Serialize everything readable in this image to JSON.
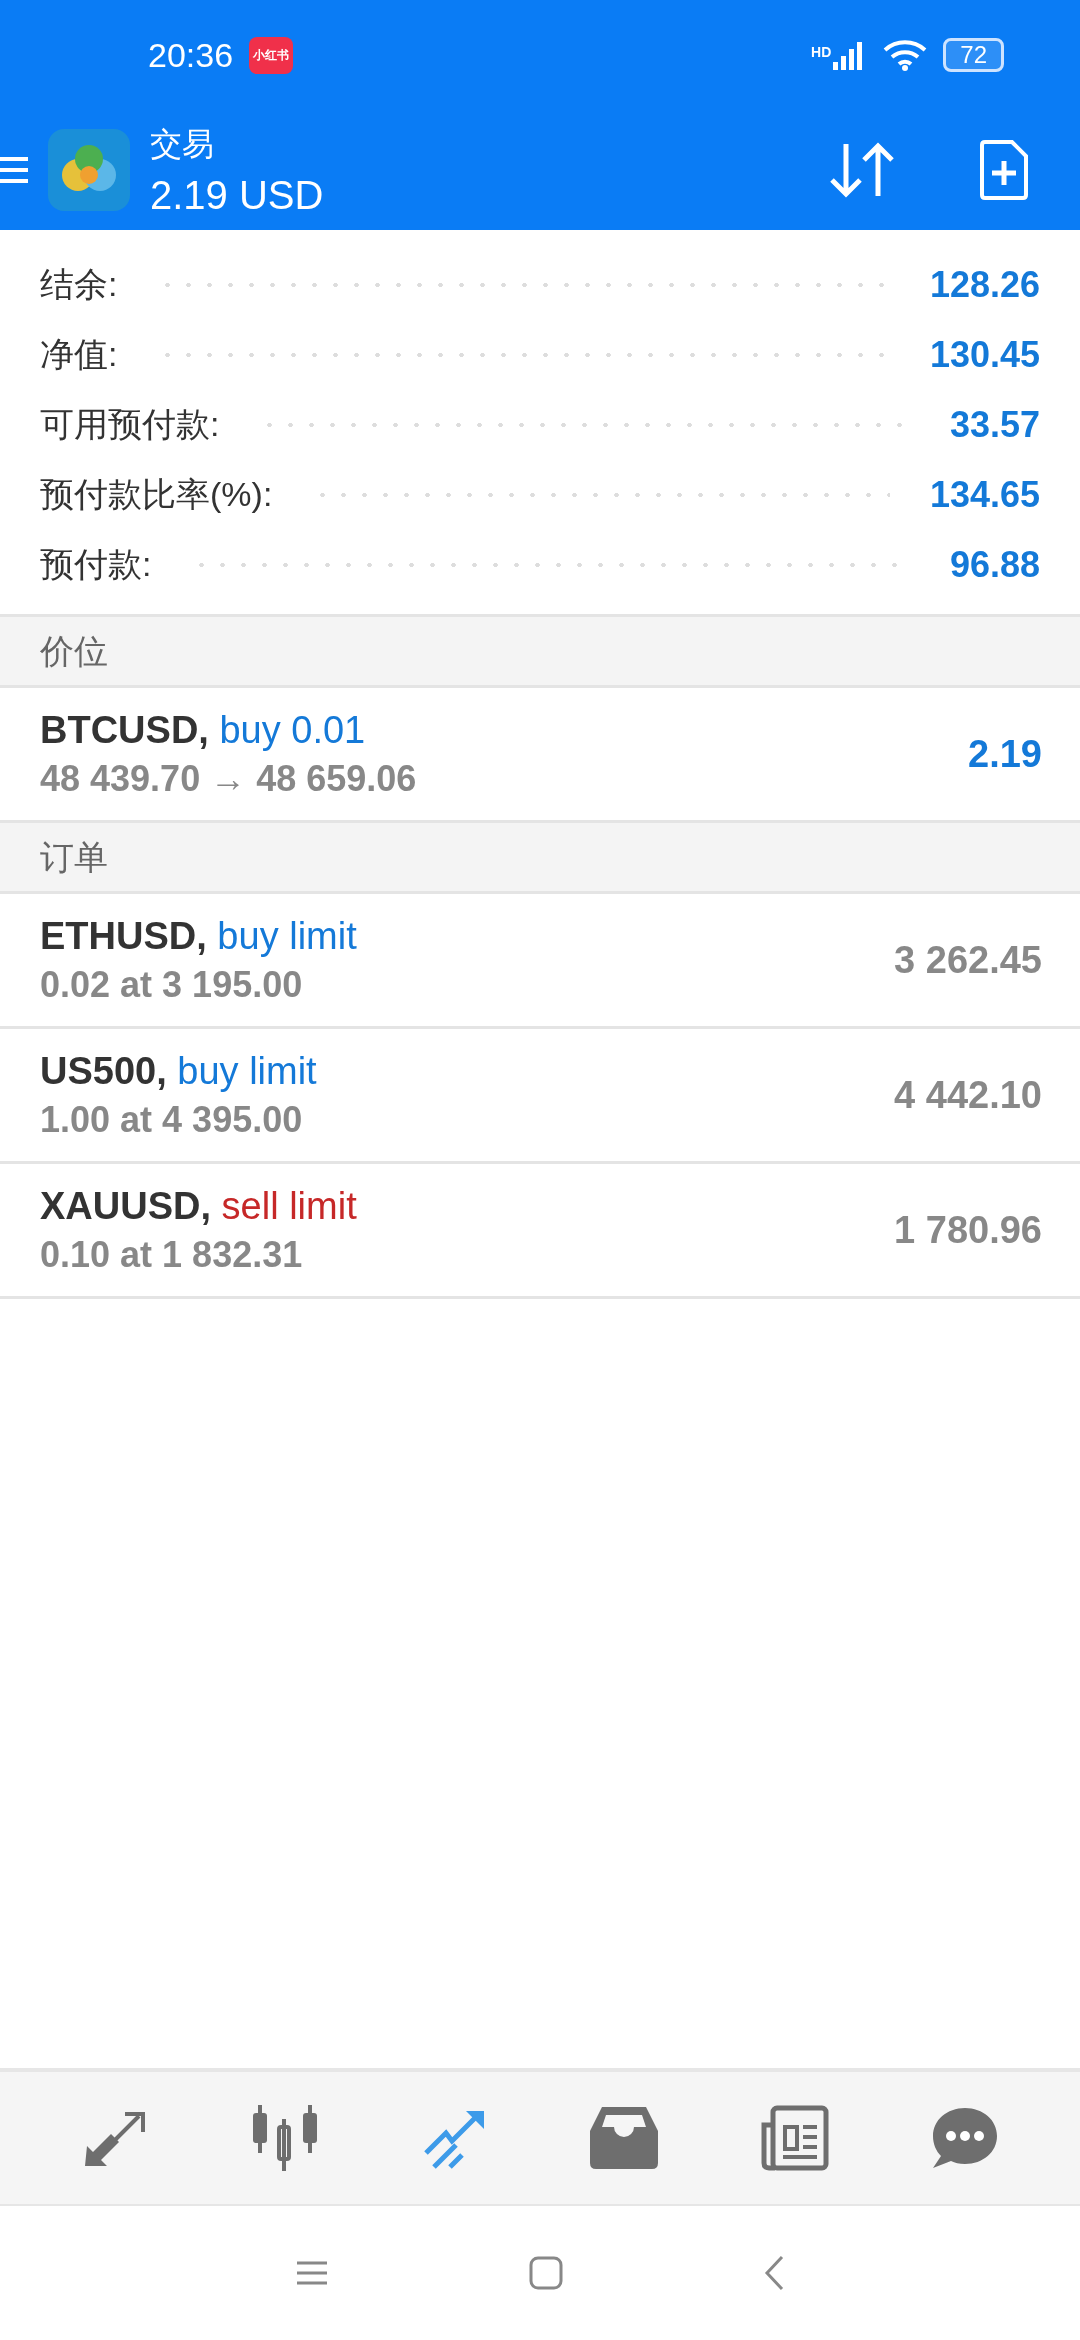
{
  "status_bar": {
    "time": "20:36",
    "app_badge": "小红书",
    "network": "HD",
    "battery": "72"
  },
  "header": {
    "title": "交易",
    "balance": "2.19 USD"
  },
  "summary": [
    {
      "label": "结余:",
      "value": "128.26"
    },
    {
      "label": "净值:",
      "value": "130.45"
    },
    {
      "label": "可用预付款:",
      "value": "33.57"
    },
    {
      "label": "预付款比率(%):",
      "value": "134.65"
    },
    {
      "label": "预付款:",
      "value": "96.88"
    }
  ],
  "sections": [
    {
      "title": "价位",
      "kind": "positions",
      "items": [
        {
          "symbol": "BTCUSD,",
          "kind": "buy",
          "action": "buy 0.01",
          "detail": "48 439.70 → 48 659.06",
          "value": "2.19"
        }
      ]
    },
    {
      "title": "订单",
      "kind": "orders",
      "items": [
        {
          "symbol": "ETHUSD,",
          "kind": "buy",
          "action": "buy limit",
          "detail": "0.02 at 3 195.00",
          "value": "3 262.45"
        },
        {
          "symbol": "US500,",
          "kind": "buy",
          "action": "buy limit",
          "detail": "1.00 at 4 395.00",
          "value": "4 442.10"
        },
        {
          "symbol": "XAUUSD,",
          "kind": "sell",
          "action": "sell limit",
          "detail": "0.10 at 1 832.31",
          "value": "1 780.96"
        }
      ]
    }
  ],
  "bottom_nav": [
    {
      "kind": "quotes",
      "selected": false
    },
    {
      "kind": "chart",
      "selected": false
    },
    {
      "kind": "trade",
      "selected": true
    },
    {
      "kind": "history",
      "selected": false
    },
    {
      "kind": "news",
      "selected": false
    },
    {
      "kind": "chat",
      "selected": false
    }
  ]
}
